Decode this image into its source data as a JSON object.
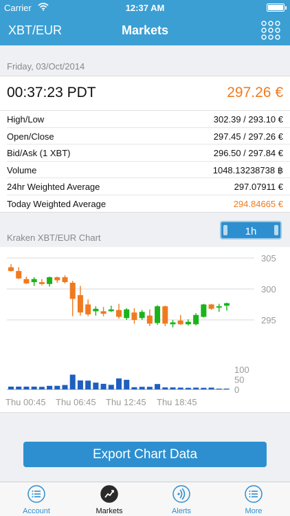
{
  "status": {
    "carrier": "Carrier",
    "time": "12:37 AM"
  },
  "nav": {
    "pair": "XBT/EUR",
    "title": "Markets"
  },
  "date_header": "Friday, 03/Oct/2014",
  "ticker": {
    "time": "00:37:23 PDT",
    "price": "297.26 €"
  },
  "stats": [
    {
      "label": "High/Low",
      "value": "302.39 / 293.10 €",
      "highlight": false
    },
    {
      "label": "Open/Close",
      "value": "297.45 / 297.26 €",
      "highlight": false
    },
    {
      "label": "Bid/Ask (1 XBT)",
      "value": "296.50 / 297.84 €",
      "highlight": false
    },
    {
      "label": "Volume",
      "value": "1048.13238738 ฿",
      "highlight": false
    },
    {
      "label": "24hr Weighted Average",
      "value": "297.07911 €",
      "highlight": false
    },
    {
      "label": "Today Weighted Average",
      "value": "294.84665 €",
      "highlight": true
    }
  ],
  "chart_header": "Kraken XBT/EUR Chart",
  "timeframe": "1h",
  "export_label": "Export Chart Data",
  "tabs": [
    {
      "label": "Account",
      "icon": "list-icon",
      "active": false
    },
    {
      "label": "Markets",
      "icon": "trend-chart-icon",
      "active": true
    },
    {
      "label": "Alerts",
      "icon": "alert-signal-icon",
      "active": false
    },
    {
      "label": "More",
      "icon": "list-icon",
      "active": false
    }
  ],
  "colors": {
    "accent": "#3b9fd4",
    "up": "#1ab31a",
    "down": "#f07a1f",
    "volume": "#1f5fbf"
  },
  "chart_data": {
    "type": "candlestick",
    "price_axis": {
      "ticks": [
        305,
        300,
        295
      ],
      "ylim": [
        293.0,
        305.0
      ]
    },
    "volume_axis": {
      "ticks": [
        100,
        50,
        0
      ],
      "ylim": [
        0,
        100
      ]
    },
    "x_tick_labels": [
      "Thu 00:45",
      "Thu 06:45",
      "Thu 12:45",
      "Thu 18:45"
    ],
    "candles": [
      {
        "open": 303.5,
        "close": 302.9,
        "high": 304.0,
        "low": 302.8,
        "volume": 14
      },
      {
        "open": 302.9,
        "close": 301.7,
        "high": 303.5,
        "low": 301.6,
        "volume": 14
      },
      {
        "open": 301.6,
        "close": 300.9,
        "high": 302.0,
        "low": 300.8,
        "volume": 14
      },
      {
        "open": 301.1,
        "close": 301.6,
        "high": 301.9,
        "low": 300.5,
        "volume": 14
      },
      {
        "open": 301.1,
        "close": 300.8,
        "high": 301.6,
        "low": 300.6,
        "volume": 13
      },
      {
        "open": 300.8,
        "close": 301.9,
        "high": 302.0,
        "low": 300.4,
        "volume": 18
      },
      {
        "open": 301.9,
        "close": 301.4,
        "high": 302.0,
        "low": 301.0,
        "volume": 18
      },
      {
        "open": 301.9,
        "close": 301.1,
        "high": 302.2,
        "low": 300.9,
        "volume": 22
      },
      {
        "open": 301.0,
        "close": 298.4,
        "high": 301.3,
        "low": 295.6,
        "volume": 74
      },
      {
        "open": 299.0,
        "close": 296.2,
        "high": 300.5,
        "low": 295.7,
        "volume": 45
      },
      {
        "open": 297.5,
        "close": 295.9,
        "high": 298.3,
        "low": 295.6,
        "volume": 44
      },
      {
        "open": 296.4,
        "close": 296.8,
        "high": 297.2,
        "low": 295.7,
        "volume": 34
      },
      {
        "open": 296.4,
        "close": 296.0,
        "high": 297.1,
        "low": 295.6,
        "volume": 28
      },
      {
        "open": 296.4,
        "close": 296.7,
        "high": 297.3,
        "low": 296.3,
        "volume": 23
      },
      {
        "open": 296.6,
        "close": 295.5,
        "high": 297.6,
        "low": 295.2,
        "volume": 55
      },
      {
        "open": 295.3,
        "close": 296.7,
        "high": 296.9,
        "low": 295.0,
        "volume": 48
      },
      {
        "open": 296.2,
        "close": 295.0,
        "high": 296.9,
        "low": 294.4,
        "volume": 11
      },
      {
        "open": 295.3,
        "close": 296.3,
        "high": 296.6,
        "low": 295.0,
        "volume": 13
      },
      {
        "open": 295.7,
        "close": 294.4,
        "high": 296.7,
        "low": 294.0,
        "volume": 13
      },
      {
        "open": 294.5,
        "close": 297.2,
        "high": 297.4,
        "low": 294.2,
        "volume": 27
      },
      {
        "open": 297.2,
        "close": 294.4,
        "high": 297.3,
        "low": 294.0,
        "volume": 10
      },
      {
        "open": 294.3,
        "close": 294.6,
        "high": 295.0,
        "low": 293.8,
        "volume": 10
      },
      {
        "open": 294.9,
        "close": 294.3,
        "high": 295.8,
        "low": 294.2,
        "volume": 9
      },
      {
        "open": 294.3,
        "close": 294.7,
        "high": 295.1,
        "low": 294.1,
        "volume": 8
      },
      {
        "open": 294.3,
        "close": 295.8,
        "high": 296.1,
        "low": 294.1,
        "volume": 9
      },
      {
        "open": 295.5,
        "close": 297.5,
        "high": 297.6,
        "low": 295.4,
        "volume": 8
      },
      {
        "open": 297.5,
        "close": 296.8,
        "high": 297.6,
        "low": 296.6,
        "volume": 9
      },
      {
        "open": 297.0,
        "close": 297.2,
        "high": 297.6,
        "low": 296.3,
        "volume": 4
      },
      {
        "open": 297.3,
        "close": 297.7,
        "high": 297.8,
        "low": 296.5,
        "volume": 4
      }
    ]
  }
}
